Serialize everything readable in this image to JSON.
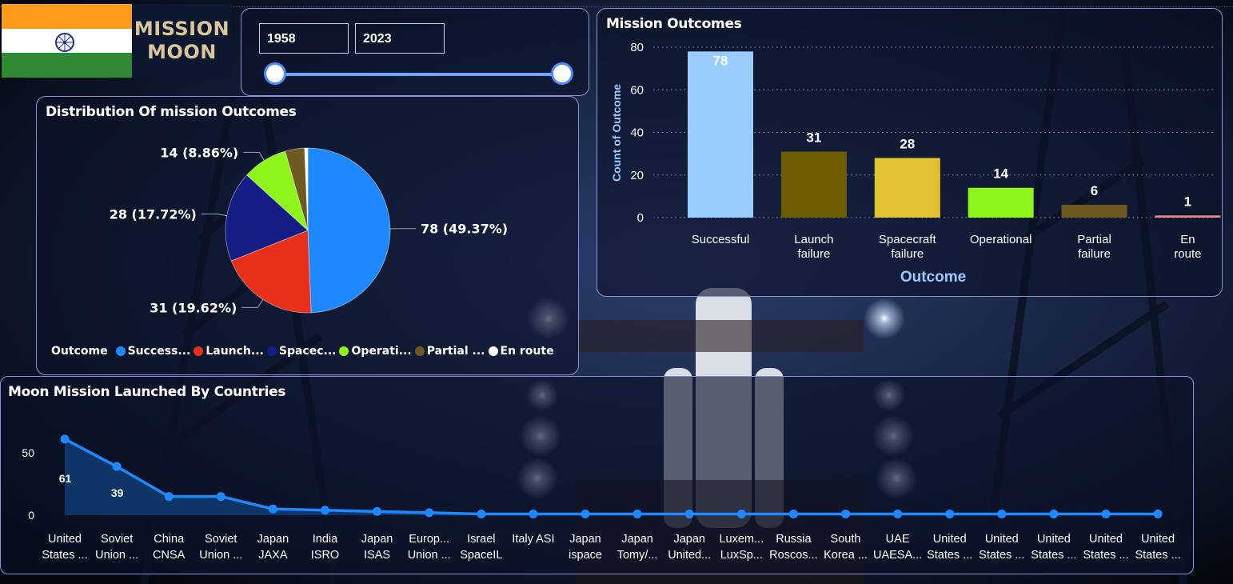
{
  "brand": {
    "line1": "MISSION",
    "line2": "MOON"
  },
  "year_slider": {
    "start": "1958",
    "end": "2023"
  },
  "pie_card": {
    "title": "Distribution Of mission Outcomes",
    "legend_title": "Outcome",
    "legend_items": [
      "Success...",
      "Launch...",
      "Spacec...",
      "Operati...",
      "Partial ...",
      "En route"
    ]
  },
  "bar_card": {
    "title": "Mission Outcomes"
  },
  "line_card": {
    "title": "Moon Mission Launched By Countries"
  },
  "colors": {
    "successful": "#1e88ff",
    "launch_failure": "#e8301a",
    "spacecraft_failure": "#141c86",
    "operational": "#8ef51a",
    "partial_failure": "#6e5a20",
    "en_route": "#ffffff",
    "bar_successful": "#99cdff",
    "bar_launch_failure": "#6e5c00",
    "bar_spacecraft_failure": "#e0c132",
    "bar_operational": "#8ef51a",
    "bar_partial_failure": "#6e5a20",
    "bar_en_route": "#f08a8a",
    "line": "#1e88ff",
    "area": "#0d3a6e"
  },
  "chart_data": [
    {
      "type": "pie",
      "title": "Distribution Of mission Outcomes",
      "categories": [
        "Successful",
        "Launch failure",
        "Spacecraft failure",
        "Operational",
        "Partial failure",
        "En route"
      ],
      "values": [
        78,
        31,
        28,
        14,
        6,
        1
      ],
      "data_labels": [
        "78 (49.37%)",
        "31 (19.62%)",
        "28 (17.72%)",
        "14 (8.86%)",
        "",
        ""
      ],
      "legend": "bottom"
    },
    {
      "type": "bar",
      "title": "Mission Outcomes",
      "categories": [
        "Successful",
        "Launch failure",
        "Spacecraft failure",
        "Operational",
        "Partial failure",
        "En route"
      ],
      "values": [
        78,
        31,
        28,
        14,
        6,
        1
      ],
      "xlabel": "Outcome",
      "ylabel": "Count of Outcome",
      "ylim": [
        0,
        80
      ],
      "yticks": [
        0,
        20,
        40,
        60,
        80
      ],
      "grid": true
    },
    {
      "type": "area",
      "title": "Moon Mission Launched By Countries",
      "categories": [
        [
          "United",
          "States ..."
        ],
        [
          "Soviet",
          "Union ..."
        ],
        [
          "China",
          "CNSA"
        ],
        [
          "Soviet",
          "Union ..."
        ],
        [
          "Japan",
          "JAXA"
        ],
        [
          "India",
          "ISRO"
        ],
        [
          "Japan",
          "ISAS"
        ],
        [
          "Europ...",
          "Union ..."
        ],
        [
          "Israel",
          "SpaceIL"
        ],
        [
          "Italy ASI",
          ""
        ],
        [
          "Japan",
          "ispace"
        ],
        [
          "Japan",
          "Tomy/..."
        ],
        [
          "Japan",
          "United..."
        ],
        [
          "Luxem...",
          "LuxSp..."
        ],
        [
          "Russia",
          "Roscos..."
        ],
        [
          "South",
          "Korea ..."
        ],
        [
          "UAE",
          "UAESA..."
        ],
        [
          "United",
          "States ..."
        ],
        [
          "United",
          "States ..."
        ],
        [
          "United",
          "States ..."
        ],
        [
          "United",
          "States ..."
        ],
        [
          "United",
          "States ..."
        ]
      ],
      "values": [
        61,
        39,
        15,
        15,
        5,
        4,
        3,
        2,
        1,
        1,
        1,
        1,
        1,
        1,
        1,
        1,
        1,
        1,
        1,
        1,
        1,
        1
      ],
      "point_labels": [
        "61",
        "39"
      ],
      "yticks": [
        0,
        50
      ],
      "ylim": [
        0,
        65
      ]
    }
  ]
}
